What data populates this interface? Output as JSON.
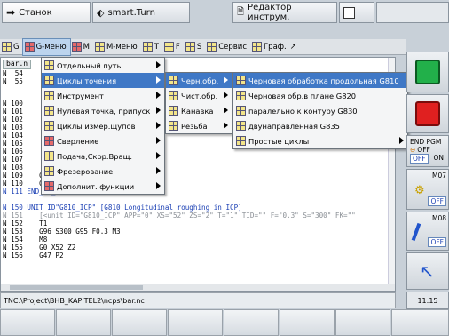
{
  "tabs": [
    {
      "label": "Станок",
      "icon": "machine-arrow-icon"
    },
    {
      "label": "smart.Turn",
      "icon": "turn-arrows-icon"
    },
    {
      "label": "Редактор инструм.",
      "icon": "tool-editor-icon"
    },
    {
      "label": "",
      "icon": "save-icon"
    }
  ],
  "menubar": [
    {
      "label": "G"
    },
    {
      "label": "G-меню",
      "selected": true
    },
    {
      "label": "M"
    },
    {
      "label": "M-меню"
    },
    {
      "label": "T"
    },
    {
      "label": "F"
    },
    {
      "label": "S"
    },
    {
      "label": "Сервис"
    },
    {
      "label": "Граф."
    }
  ],
  "editor": {
    "filename": "bar.n",
    "lines": [
      {
        "text": "N  54"
      },
      {
        "text": "N  55"
      },
      {
        "text": "N 100"
      },
      {
        "text": "N 101"
      },
      {
        "text": "N 102"
      },
      {
        "text": "N 103"
      },
      {
        "text": "N 104"
      },
      {
        "text": "N 105"
      },
      {
        "text": "N 106"
      },
      {
        "text": "N 107"
      },
      {
        "text": "N 108"
      },
      {
        "text": "N 109    G14 Q0"
      },
      {
        "text": "N 110    G47 M9"
      },
      {
        "text": "N 111 END_OF_UNIT S3070822274"
      },
      {
        "text": ""
      },
      {
        "text": "N 150 UNIT ID\"G810_ICP\" [G810 Longitudinal roughing in ICP]"
      },
      {
        "text": "N 151    [<unit ID=\"G810_ICP\" APP=\"0\" XS=\"52\" ZS=\"2\" T=\"1\" TID=\"\" F=\"0.3\" S=\"300\" FK=\"\""
      },
      {
        "text": "N 152    T1"
      },
      {
        "text": "N 153    G96 S300 G95 F0.3 M3"
      },
      {
        "text": "N 154    M8"
      },
      {
        "text": "N 155    G0 X52 Z2"
      },
      {
        "text": "N 156    G47 P2"
      }
    ]
  },
  "menu1": [
    {
      "label": "Отдельный путь",
      "sub": true
    },
    {
      "label": "Циклы точения",
      "sub": true,
      "hover": true
    },
    {
      "label": "Инструмент",
      "sub": true
    },
    {
      "label": "Нулевая точка, припуск",
      "sub": true
    },
    {
      "label": "Циклы измер.щупов",
      "sub": true
    },
    {
      "label": "Сверление",
      "sub": true
    },
    {
      "label": "Подача,Скор.Вращ.",
      "sub": true
    },
    {
      "label": "Фрезерование",
      "sub": true
    },
    {
      "label": "Дополнит. функции",
      "sub": true
    }
  ],
  "menu2": [
    {
      "label": "Черн.обр.",
      "sub": true,
      "hover": true
    },
    {
      "label": "Чист.обр.",
      "sub": true
    },
    {
      "label": "Канавка",
      "sub": true
    },
    {
      "label": "Резьба",
      "sub": true
    }
  ],
  "menu3": [
    {
      "label": "Черновая обработка продольная G810",
      "hover": true
    },
    {
      "label": "Черновая обр.в плане  G820"
    },
    {
      "label": "паралельно к контуру   G830"
    },
    {
      "label": "двунаправленная    G835"
    },
    {
      "label": "Простые циклы",
      "sub": true
    }
  ],
  "right_panel": {
    "end_pgm": "END PGM",
    "off_a": "OFF",
    "off_b": "OFF",
    "on": "ON",
    "m07": "M07",
    "m08": "M08",
    "off_c": "OFF",
    "off_d": "OFF",
    "time": "11:15"
  },
  "status": {
    "path": "TNC:\\Project\\BHB_KAPITEL2\\ncps\\bar.nc"
  },
  "colors": {
    "menu_hover": "#3f78c6",
    "keyword_blue": "#1a3fb4",
    "led_green": "#22b04a",
    "led_red": "#e02020"
  }
}
